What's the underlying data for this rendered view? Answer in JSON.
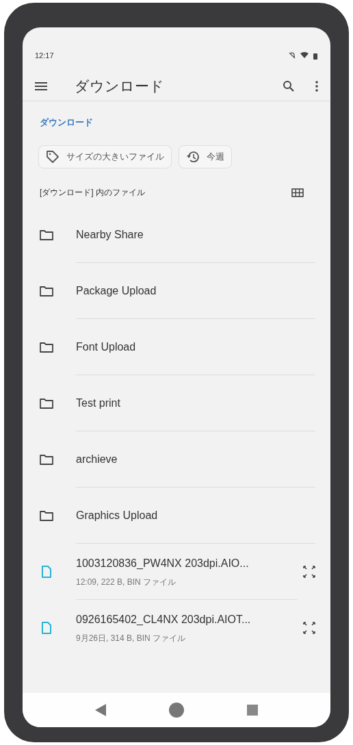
{
  "status_bar": {
    "time": "12:17"
  },
  "toolbar": {
    "title": "ダウンロード"
  },
  "breadcrumb": "ダウンロード",
  "chips": [
    {
      "kind": "tag",
      "label": "サイズの大きいファイル"
    },
    {
      "kind": "history",
      "label": "今週"
    }
  ],
  "section": {
    "title": "[ダウンロード] 内のファイル"
  },
  "items": [
    {
      "kind": "folder",
      "name": "Nearby Share"
    },
    {
      "kind": "folder",
      "name": "Package Upload"
    },
    {
      "kind": "folder",
      "name": "Font Upload"
    },
    {
      "kind": "folder",
      "name": "Test print"
    },
    {
      "kind": "folder",
      "name": "archieve"
    },
    {
      "kind": "folder",
      "name": "Graphics Upload"
    },
    {
      "kind": "file",
      "name": "1003120836_PW4NX 203dpi.AIO...",
      "details": "12:09, 222 B, BIN ファイル"
    },
    {
      "kind": "file",
      "name": "0926165402_CL4NX 203dpi.AIOT...",
      "details": "9月26日, 314 B, BIN ファイル"
    }
  ]
}
